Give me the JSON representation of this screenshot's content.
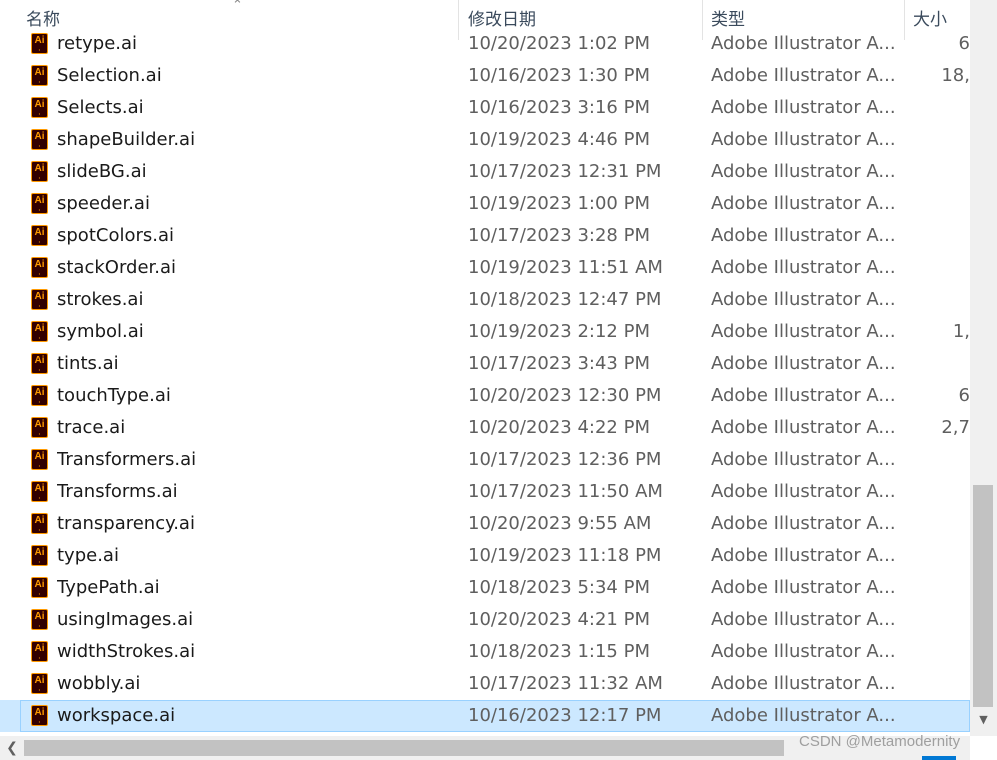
{
  "columns": {
    "name": "名称",
    "date": "修改日期",
    "type": "类型",
    "size": "大小"
  },
  "icons": {
    "sort": "chevron-up-icon",
    "file": "adobe-illustrator-file-icon"
  },
  "files": [
    {
      "name": "retype.ai",
      "date": "10/20/2023 1:02 PM",
      "type": "Adobe Illustrator A...",
      "size": "6"
    },
    {
      "name": "Selection.ai",
      "date": "10/16/2023 1:30 PM",
      "type": "Adobe Illustrator A...",
      "size": "18,"
    },
    {
      "name": "Selects.ai",
      "date": "10/16/2023 3:16 PM",
      "type": "Adobe Illustrator A...",
      "size": ""
    },
    {
      "name": "shapeBuilder.ai",
      "date": "10/19/2023 4:46 PM",
      "type": "Adobe Illustrator A...",
      "size": ""
    },
    {
      "name": "slideBG.ai",
      "date": "10/17/2023 12:31 PM",
      "type": "Adobe Illustrator A...",
      "size": ""
    },
    {
      "name": "speeder.ai",
      "date": "10/19/2023 1:00 PM",
      "type": "Adobe Illustrator A...",
      "size": ""
    },
    {
      "name": "spotColors.ai",
      "date": "10/17/2023 3:28 PM",
      "type": "Adobe Illustrator A...",
      "size": ""
    },
    {
      "name": "stackOrder.ai",
      "date": "10/19/2023 11:51 AM",
      "type": "Adobe Illustrator A...",
      "size": ""
    },
    {
      "name": "strokes.ai",
      "date": "10/18/2023 12:47 PM",
      "type": "Adobe Illustrator A...",
      "size": ""
    },
    {
      "name": "symbol.ai",
      "date": "10/19/2023 2:12 PM",
      "type": "Adobe Illustrator A...",
      "size": "1,"
    },
    {
      "name": "tints.ai",
      "date": "10/17/2023 3:43 PM",
      "type": "Adobe Illustrator A...",
      "size": ""
    },
    {
      "name": "touchType.ai",
      "date": "10/20/2023 12:30 PM",
      "type": "Adobe Illustrator A...",
      "size": "6"
    },
    {
      "name": "trace.ai",
      "date": "10/20/2023 4:22 PM",
      "type": "Adobe Illustrator A...",
      "size": "2,7"
    },
    {
      "name": "Transformers.ai",
      "date": "10/17/2023 12:36 PM",
      "type": "Adobe Illustrator A...",
      "size": ""
    },
    {
      "name": "Transforms.ai",
      "date": "10/17/2023 11:50 AM",
      "type": "Adobe Illustrator A...",
      "size": ""
    },
    {
      "name": "transparency.ai",
      "date": "10/20/2023 9:55 AM",
      "type": "Adobe Illustrator A...",
      "size": ""
    },
    {
      "name": "type.ai",
      "date": "10/19/2023 11:18 PM",
      "type": "Adobe Illustrator A...",
      "size": ""
    },
    {
      "name": "TypePath.ai",
      "date": "10/18/2023 5:34 PM",
      "type": "Adobe Illustrator A...",
      "size": ""
    },
    {
      "name": "usingImages.ai",
      "date": "10/20/2023 4:21 PM",
      "type": "Adobe Illustrator A...",
      "size": ""
    },
    {
      "name": "widthStrokes.ai",
      "date": "10/18/2023 1:15 PM",
      "type": "Adobe Illustrator A...",
      "size": ""
    },
    {
      "name": "wobbly.ai",
      "date": "10/17/2023 11:32 AM",
      "type": "Adobe Illustrator A...",
      "size": ""
    },
    {
      "name": "workspace.ai",
      "date": "10/16/2023 12:17 PM",
      "type": "Adobe Illustrator A...",
      "size": "",
      "selected": true
    }
  ],
  "file_icon_text": "Ai",
  "watermark": "CSDN @Metamodernity",
  "colors": {
    "selection": "#cce8ff",
    "ai_orange": "#ff9a00",
    "ai_bg": "#330000"
  }
}
